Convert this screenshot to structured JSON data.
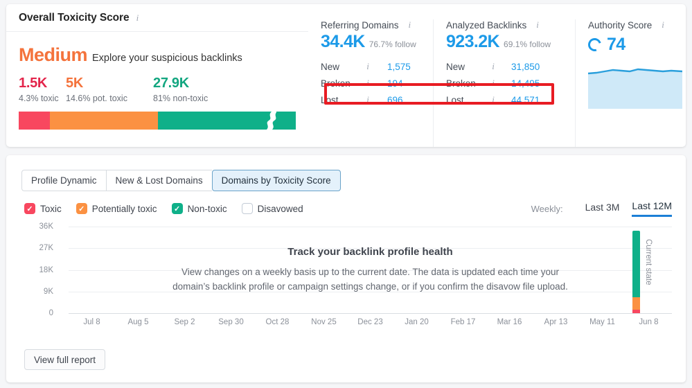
{
  "toxicity": {
    "card_title": "Overall Toxicity Score",
    "info_icon": "info-icon",
    "grade": "Medium",
    "grade_subtitle": "Explore your suspicious backlinks",
    "stats": [
      {
        "value": "1.5K",
        "label": "4.3% toxic",
        "color": "#e3254b"
      },
      {
        "value": "5K",
        "label": "14.6% pot. toxic",
        "color": "#f4733c"
      },
      {
        "value": "27.9K",
        "label": "81% non-toxic",
        "color": "#13a680"
      }
    ],
    "bar_segments": [
      {
        "name": "toxic",
        "percent": 4.3,
        "color": "#f8475f"
      },
      {
        "name": "potentially-toxic",
        "percent": 14.6,
        "color": "#fb9142"
      },
      {
        "name": "non-toxic",
        "percent": 81,
        "color": "#0fb089"
      }
    ]
  },
  "metrics": {
    "referring_domains": {
      "title": "Referring Domains",
      "value": "34.4K",
      "follow": "76.7% follow",
      "rows": [
        {
          "label": "New",
          "value": "1,575"
        },
        {
          "label": "Broken",
          "value": "194"
        },
        {
          "label": "Lost",
          "value": "696"
        }
      ]
    },
    "analyzed_backlinks": {
      "title": "Analyzed Backlinks",
      "value": "923.2K",
      "follow": "69.1% follow",
      "rows": [
        {
          "label": "New",
          "value": "31,850"
        },
        {
          "label": "Broken",
          "value": "14,495"
        },
        {
          "label": "Lost",
          "value": "44,571"
        }
      ]
    },
    "authority_score": {
      "title": "Authority Score",
      "value": "74"
    },
    "highlight_color": "#e81c23"
  },
  "panel": {
    "tabs": [
      {
        "label": "Profile Dynamic",
        "active": false
      },
      {
        "label": "New & Lost Domains",
        "active": false
      },
      {
        "label": "Domains by Toxicity Score",
        "active": true
      }
    ],
    "filters": [
      {
        "label": "Toxic",
        "checked": true,
        "color": "#f8475f"
      },
      {
        "label": "Potentially toxic",
        "checked": true,
        "color": "#fb9142"
      },
      {
        "label": "Non-toxic",
        "checked": true,
        "color": "#0fb089"
      },
      {
        "label": "Disavowed",
        "checked": false,
        "color": "#ffffff"
      }
    ],
    "period_label": "Weekly:",
    "periods": [
      {
        "label": "Last 3M",
        "active": false
      },
      {
        "label": "Last 12M",
        "active": true
      }
    ],
    "overlay": {
      "title": "Track your backlink profile health",
      "line1": "View changes on a weekly basis up to the current date. The data is updated each time your",
      "line2": "domain’s backlink profile or campaign settings change, or if you confirm the disavow file upload."
    },
    "current_state_label": "Current state",
    "report_button": "View full report"
  },
  "chart_data": {
    "type": "bar",
    "title": "Domains by Toxicity Score",
    "xlabel": "",
    "ylabel": "",
    "ylim": [
      0,
      36000
    ],
    "yticks": [
      "36K",
      "27K",
      "18K",
      "9K",
      "0"
    ],
    "ytick_values": [
      36000,
      27000,
      18000,
      9000,
      0
    ],
    "grid": true,
    "legend_position": "top-left",
    "categories": [
      "Jul 8",
      "Aug 5",
      "Sep 2",
      "Sep 30",
      "Oct 28",
      "Nov 25",
      "Dec 23",
      "Jan 20",
      "Feb 17",
      "Mar 16",
      "Apr 13",
      "May 11",
      "Jun 8"
    ],
    "series": [
      {
        "name": "Toxic",
        "color": "#f8475f",
        "values": [
          null,
          null,
          null,
          null,
          null,
          null,
          null,
          null,
          null,
          null,
          null,
          null,
          1500
        ]
      },
      {
        "name": "Potentially toxic",
        "color": "#fb9142",
        "values": [
          null,
          null,
          null,
          null,
          null,
          null,
          null,
          null,
          null,
          null,
          null,
          null,
          5000
        ]
      },
      {
        "name": "Non-toxic",
        "color": "#0fb089",
        "values": [
          null,
          null,
          null,
          null,
          null,
          null,
          null,
          null,
          null,
          null,
          null,
          null,
          27900
        ]
      }
    ],
    "annotations": [
      "Current state"
    ],
    "note": "Only the final (current state) stacked bar has data; prior weeks are empty and covered by an explanatory overlay."
  }
}
